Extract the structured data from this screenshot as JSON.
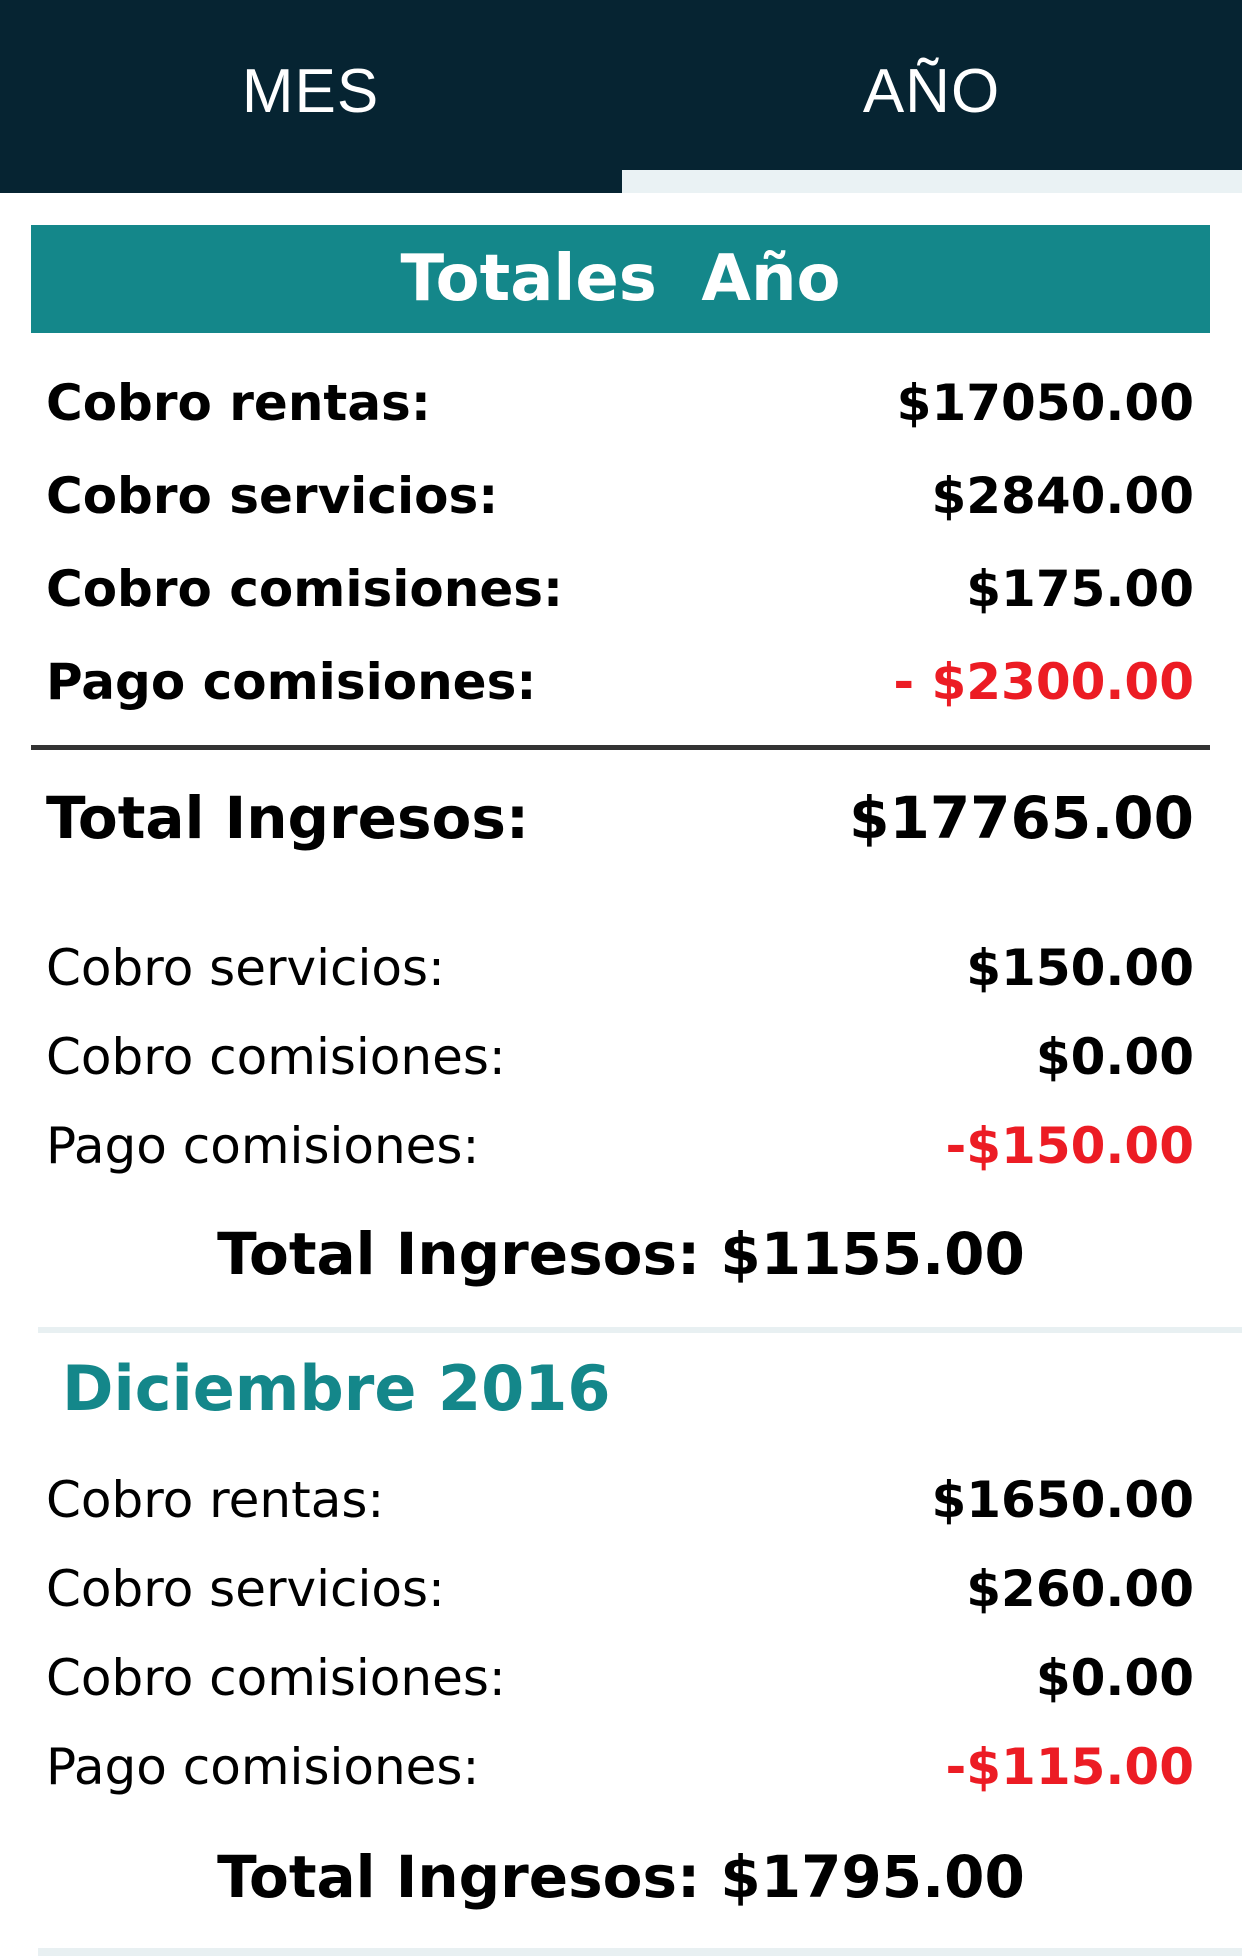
{
  "tabs": {
    "mes": "MES",
    "ano": "AÑO"
  },
  "colors": {
    "tabbar_bg": "#062432",
    "accent_teal": "#14878a",
    "negative_red": "#ec1c24"
  },
  "year_totals": {
    "title": "Totales  Año",
    "rows": [
      {
        "label": "Cobro rentas:",
        "value": "$17050.00"
      },
      {
        "label": "Cobro servicios:",
        "value": "$2840.00"
      },
      {
        "label": "Cobro comisiones:",
        "value": "$175.00"
      },
      {
        "label": "Pago comisiones:",
        "value": "- $2300.00"
      }
    ],
    "total_label": "Total Ingresos:",
    "total_value": "$17765.00"
  },
  "previous_month": {
    "rows": [
      {
        "label": "Cobro servicios:",
        "value": "$150.00"
      },
      {
        "label": "Cobro comisiones:",
        "value": "$0.00"
      },
      {
        "label": "Pago comisiones:",
        "value": "-$150.00"
      }
    ],
    "total": "Total Ingresos: $1155.00"
  },
  "december": {
    "title": "Diciembre 2016",
    "rows": [
      {
        "label": "Cobro rentas:",
        "value": "$1650.00"
      },
      {
        "label": "Cobro servicios:",
        "value": "$260.00"
      },
      {
        "label": "Cobro comisiones:",
        "value": "$0.00"
      },
      {
        "label": "Pago comisiones:",
        "value": "-$115.00"
      }
    ],
    "total": "Total Ingresos: $1795.00"
  }
}
